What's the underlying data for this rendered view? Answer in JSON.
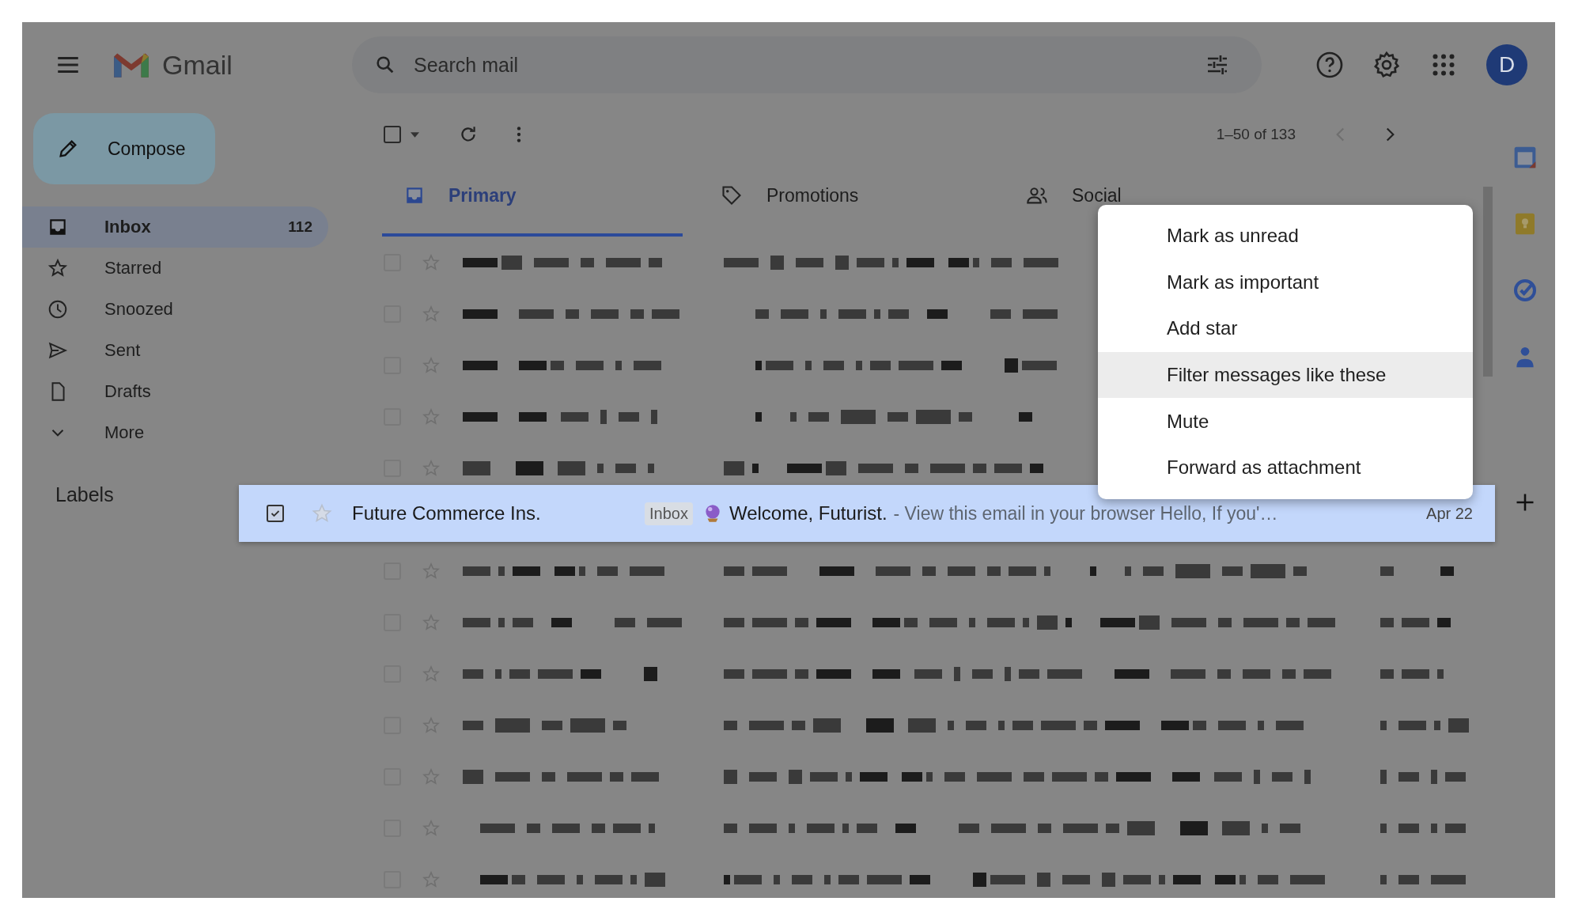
{
  "app": {
    "name": "Gmail"
  },
  "search": {
    "placeholder": "Search mail"
  },
  "account": {
    "initial": "D"
  },
  "compose": {
    "label": "Compose"
  },
  "nav": [
    {
      "kind": "inbox",
      "label": "Inbox",
      "count": "112",
      "selected": true
    },
    {
      "kind": "star",
      "label": "Starred",
      "selected": false
    },
    {
      "kind": "clock",
      "label": "Snoozed",
      "selected": false
    },
    {
      "kind": "send",
      "label": "Sent",
      "selected": false
    },
    {
      "kind": "file",
      "label": "Drafts",
      "selected": false
    },
    {
      "kind": "chevron",
      "label": "More",
      "selected": false
    }
  ],
  "labels_heading": "Labels",
  "toolbar": {
    "select_all_checked": false,
    "range": "1–50 of 133"
  },
  "tabs": [
    {
      "kind": "inbox",
      "label": "Primary",
      "selected": true
    },
    {
      "kind": "tag",
      "label": "Promotions",
      "selected": false
    },
    {
      "kind": "people",
      "label": "Social",
      "selected": false
    }
  ],
  "rows": [
    {
      "checked": false,
      "starred": false
    },
    {
      "checked": false,
      "starred": false
    },
    {
      "checked": false,
      "starred": false
    },
    {
      "checked": false,
      "starred": false
    },
    {
      "checked": false,
      "starred": false
    },
    {
      "checked": false,
      "starred": false
    },
    {
      "checked": false,
      "starred": false
    },
    {
      "checked": false,
      "starred": false
    },
    {
      "checked": false,
      "starred": false
    },
    {
      "checked": false,
      "starred": false
    },
    {
      "checked": false,
      "starred": false
    },
    {
      "checked": false,
      "starred": false
    }
  ],
  "dragged_row": {
    "checked": true,
    "starred": false,
    "sender": "Future Commerce Ins.",
    "label": "Inbox",
    "subject": "Welcome, Futurist.",
    "snippet": "- View this email in your browser Hello, If you'…",
    "date": "Apr 22"
  },
  "context_menu": [
    {
      "label": "Mark as unread",
      "selected": false
    },
    {
      "label": "Mark as important",
      "selected": false
    },
    {
      "label": "Add star",
      "selected": false
    },
    {
      "label": "Filter messages like these",
      "selected": true
    },
    {
      "label": "Mute",
      "selected": false
    },
    {
      "label": "Forward as attachment",
      "selected": false
    }
  ]
}
